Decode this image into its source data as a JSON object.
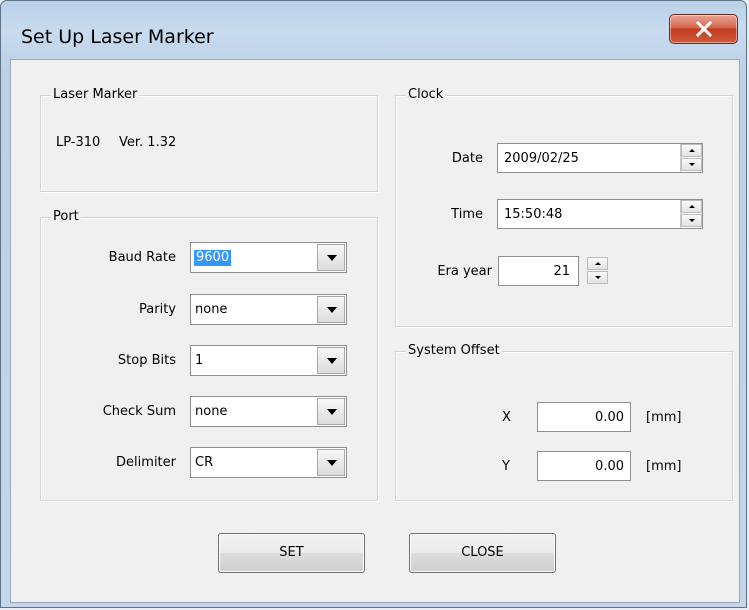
{
  "window": {
    "title": "Set Up Laser Marker"
  },
  "laser_marker": {
    "legend": "Laser Marker",
    "model": "LP-310",
    "version": "Ver. 1.32"
  },
  "port": {
    "legend": "Port",
    "baud_rate": {
      "label": "Baud Rate",
      "value": "9600"
    },
    "parity": {
      "label": "Parity",
      "value": "none"
    },
    "stop_bits": {
      "label": "Stop Bits",
      "value": "1"
    },
    "check_sum": {
      "label": "Check Sum",
      "value": "none"
    },
    "delimiter": {
      "label": "Delimiter",
      "value": "CR"
    }
  },
  "clock": {
    "legend": "Clock",
    "date": {
      "label": "Date",
      "value": "2009/02/25"
    },
    "time": {
      "label": "Time",
      "value": "15:50:48"
    },
    "era_year": {
      "label": "Era year",
      "value": "21"
    }
  },
  "system_offset": {
    "legend": "System Offset",
    "x": {
      "label": "X",
      "value": "0.00",
      "unit": "[mm]"
    },
    "y": {
      "label": "Y",
      "value": "0.00",
      "unit": "[mm]"
    }
  },
  "buttons": {
    "set": "SET",
    "close": "CLOSE"
  },
  "icons": {
    "close": "close-icon",
    "dropdown": "chevron-down-icon",
    "spinner": "spin-up-down-icon"
  },
  "colors": {
    "selection": "#3399ff",
    "close_button": "#c43c21"
  }
}
